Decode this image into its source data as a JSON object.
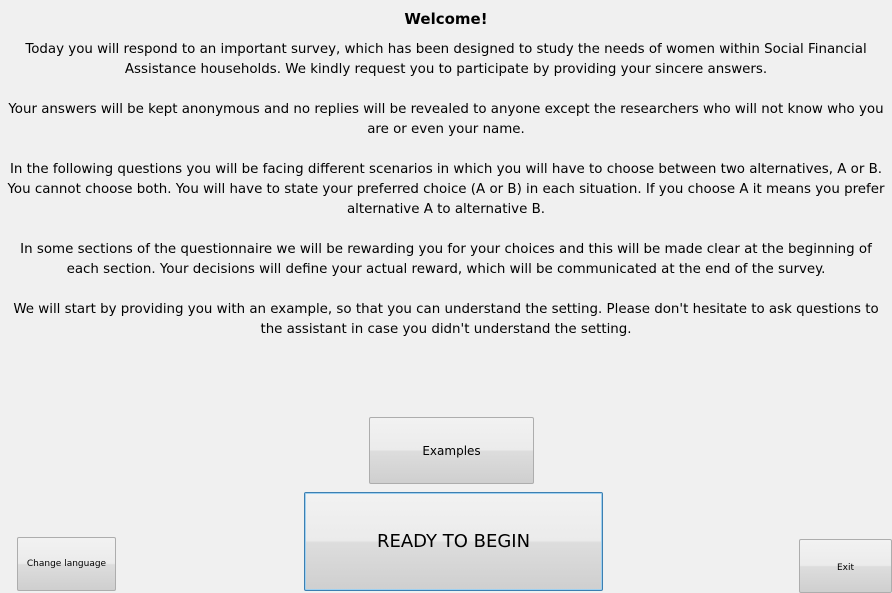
{
  "window": {
    "title": "Welcome!"
  },
  "intro": {
    "paragraphs": [
      "Today you will respond to an important survey, which has been designed to study the needs of women within Social Financial Assistance households. We kindly request you to participate by providing your sincere answers.",
      "Your answers will be kept anonymous and no replies will be revealed to anyone except the researchers who will not know who you are or even your name.",
      "In the following questions you will be facing different scenarios in which you will have to choose between two alternatives, A or B. You cannot choose both. You will have to state your preferred choice (A or B) in each situation. If you choose A it means you prefer alternative A to alternative B.",
      "In some sections of the questionnaire we will be rewarding you for your choices and this will be made clear at the beginning of each section. Your decisions will define your actual reward, which will be communicated at the end of the survey.",
      "We will start by providing you with an example, so that you can understand the setting. Please don't hesitate to ask questions to the assistant in case you didn't understand the setting."
    ]
  },
  "buttons": {
    "examples_label": "Examples",
    "ready_label": "READY TO BEGIN",
    "change_language_label": "Change language",
    "exit_label": "Exit"
  },
  "colors": {
    "background": "#f0f0f0",
    "focus_border": "#3c7fb1"
  }
}
